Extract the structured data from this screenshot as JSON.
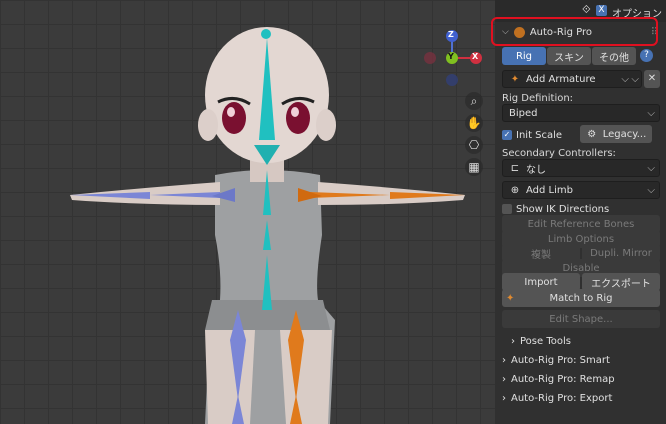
{
  "topbar": {
    "options_label": "オプション",
    "x_label": "X"
  },
  "panel": {
    "title": "Auto-Rig Pro",
    "tabs": [
      "Rig",
      "スキン",
      "その他"
    ],
    "help": "?",
    "add_armature": "Add Armature",
    "rig_definition_label": "Rig Definition:",
    "rig_definition_value": "Biped",
    "init_scale": "Init Scale",
    "init_scale_checked": true,
    "legacy": "Legacy...",
    "secondary_label": "Secondary Controllers:",
    "secondary_value": "なし",
    "add_limb": "Add Limb",
    "show_ik": "Show IK Directions",
    "edit_ref_bones": "Edit Reference Bones",
    "limb_options": "Limb Options",
    "duplicate": "複製",
    "dupli_mirror": "Dupli. Mirror",
    "disable": "Disable",
    "import": "Import",
    "export": "エクスポート",
    "match_to_rig": "Match to Rig",
    "edit_shape": "Edit Shape...",
    "pose_tools": "Pose Tools",
    "sections": [
      "Auto-Rig Pro: Smart",
      "Auto-Rig Pro: Remap",
      "Auto-Rig Pro: Export"
    ]
  },
  "gizmo": {
    "z": "Z",
    "y": "Y",
    "x": "X"
  },
  "colors": {
    "accent": "#4772b3",
    "highlight": "#e01020",
    "bone_left": "#7b86d6",
    "bone_right": "#e07a1c",
    "bone_center": "#20c0c0"
  }
}
